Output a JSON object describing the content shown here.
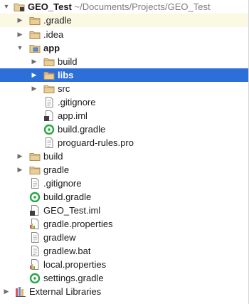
{
  "tree": {
    "root": {
      "name": "GEO_Test",
      "path": "~/Documents/Projects/GEO_Test"
    },
    "items": [
      {
        "label": ".gradle"
      },
      {
        "label": ".idea"
      },
      {
        "label": "app"
      },
      {
        "label": "build"
      },
      {
        "label": "libs"
      },
      {
        "label": "src"
      },
      {
        "label": ".gitignore"
      },
      {
        "label": "app.iml"
      },
      {
        "label": "build.gradle"
      },
      {
        "label": "proguard-rules.pro"
      },
      {
        "label": "build"
      },
      {
        "label": "gradle"
      },
      {
        "label": ".gitignore"
      },
      {
        "label": "build.gradle"
      },
      {
        "label": "GEO_Test.iml"
      },
      {
        "label": "gradle.properties"
      },
      {
        "label": "gradlew"
      },
      {
        "label": "gradlew.bat"
      },
      {
        "label": "local.properties"
      },
      {
        "label": "settings.gradle"
      },
      {
        "label": "External Libraries"
      }
    ],
    "selected_item": "libs"
  },
  "colors": {
    "selection": "#2d6fd9",
    "row_tint": "#fbf8e3",
    "folder": "#c9a769",
    "gradle_icon": "#28a745"
  }
}
